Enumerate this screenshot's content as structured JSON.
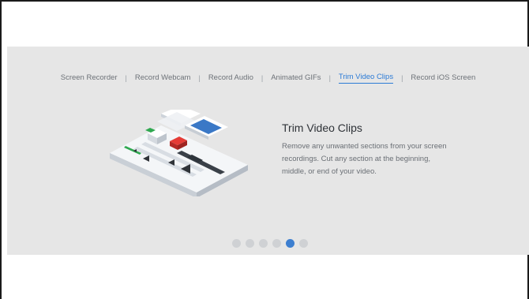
{
  "tabs": [
    {
      "label": "Screen Recorder"
    },
    {
      "label": "Record Webcam"
    },
    {
      "label": "Record Audio"
    },
    {
      "label": "Animated GIFs"
    },
    {
      "label": "Trim Video Clips"
    },
    {
      "label": "Record iOS Screen"
    }
  ],
  "active_tab_index": 4,
  "separator": "|",
  "feature": {
    "title": "Trim Video Clips",
    "description": "Remove any unwanted sections from your screen recordings. Cut any section at the beginning, middle, or end of your video."
  },
  "pagination": {
    "total": 6,
    "active_index": 4
  },
  "colors": {
    "accent": "#2c7bd6",
    "panel_bg": "#e6e6e6",
    "dot_inactive": "#cfd1d4",
    "dot_active": "#3d7fd0"
  }
}
